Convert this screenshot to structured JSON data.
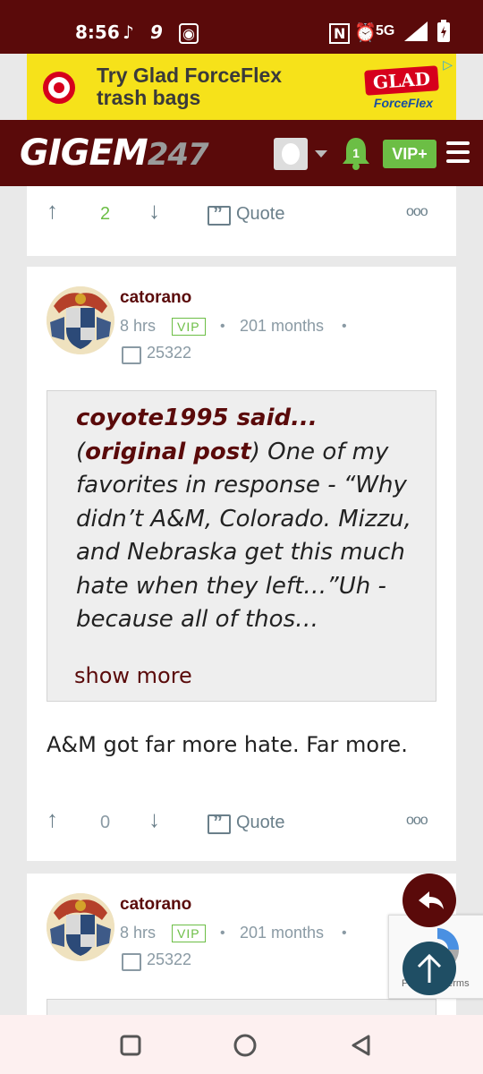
{
  "status_bar": {
    "time": "8:56",
    "network": "5G",
    "icons": [
      "tiktok-icon",
      "nine-icon",
      "radio-icon",
      "nfc-icon",
      "alarm-icon",
      "signal-icon",
      "battery-icon"
    ]
  },
  "ad": {
    "headline": "Try Glad ForceFlex trash bags",
    "brand": "GLAD",
    "brand_sub": "ForceFlex"
  },
  "nav": {
    "logo_text": "GIGEM",
    "logo_num": "247",
    "notification_count": "1",
    "vip_label": "VIP+"
  },
  "top_actions": {
    "upvotes": "2",
    "quote_label": "Quote"
  },
  "posts": [
    {
      "username": "catorano",
      "time": "8 hrs",
      "badge": "VIP",
      "tenure": "201 months",
      "post_count": "25322",
      "quote_author": "coyote1995 said...",
      "quote_open": "(",
      "quote_link": "original post",
      "quote_close": ")",
      "quote_text": " One of my favorites in response - “Why didn’t A&M, Colorado. Mizzu, and Nebraska get this much hate when they left…”Uh - because all of thos…",
      "show_more": "show more",
      "body": "A&M got far more hate. Far more.",
      "upvotes": "0",
      "quote_label": "Quote"
    },
    {
      "username": "catorano",
      "time": "8 hrs",
      "badge": "VIP",
      "tenure": "201 months",
      "post_count": "25322"
    }
  ],
  "recaptcha": {
    "label": "Privacy - Terms"
  },
  "colors": {
    "brand": "#5a0a0a",
    "vip": "#6cbe45",
    "muted": "#8a9aa4"
  }
}
